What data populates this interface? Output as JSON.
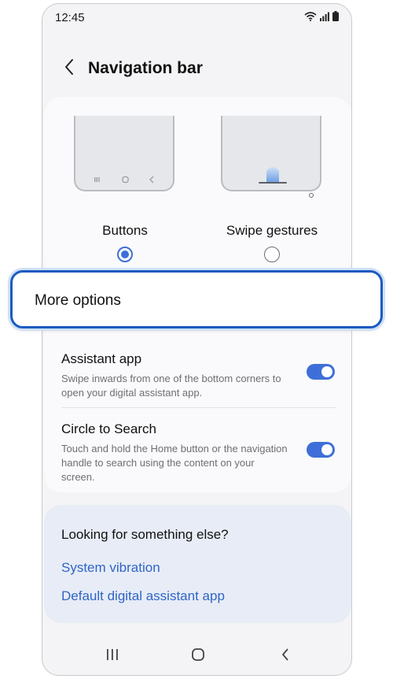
{
  "status_bar": {
    "time": "12:45",
    "icons": [
      "wifi-icon",
      "signal-icon",
      "battery-icon"
    ]
  },
  "header": {
    "title": "Navigation bar",
    "back_icon": "chevron-left-icon"
  },
  "nav_type": {
    "options": [
      {
        "label": "Buttons",
        "selected": true
      },
      {
        "label": "Swipe gestures",
        "selected": false
      }
    ]
  },
  "more_options": {
    "label": "More options"
  },
  "settings": [
    {
      "title": "Assistant app",
      "description": "Swipe inwards from one of the bottom corners to open your digital assistant app.",
      "enabled": true
    },
    {
      "title": "Circle to Search",
      "description": "Touch and hold the Home button or the navigation handle to search using the content on your screen.",
      "enabled": true
    }
  ],
  "suggestions": {
    "title": "Looking for something else?",
    "links": [
      "System vibration",
      "Default digital assistant app"
    ]
  },
  "system_nav": {
    "icons": [
      "recents-icon",
      "home-icon",
      "back-icon"
    ]
  },
  "colors": {
    "accent": "#3e6fd8",
    "highlight_border": "#1c5bbf",
    "link": "#2f65c6",
    "background": "#f4f4f6"
  }
}
